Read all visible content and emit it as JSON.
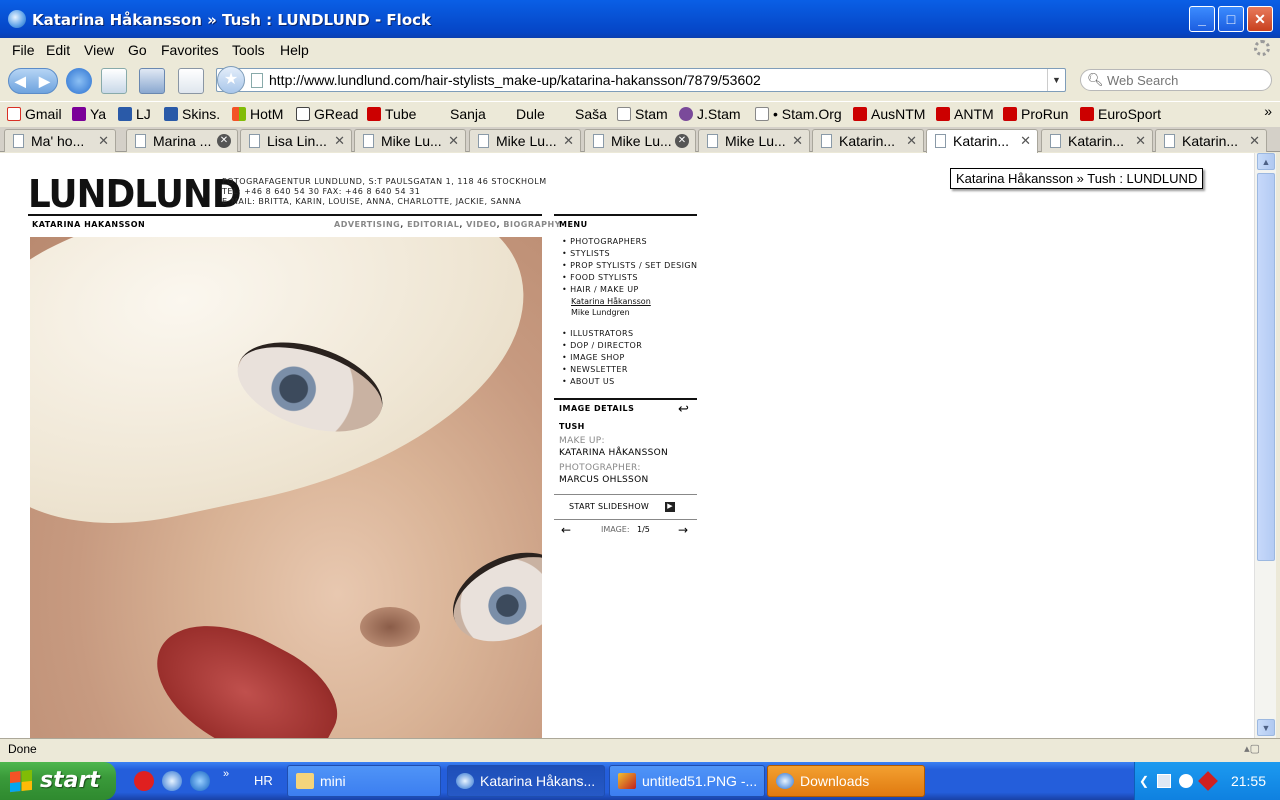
{
  "window": {
    "title": "Katarina Håkansson » Tush : LUNDLUND - Flock",
    "buttons": {
      "minimize": "_",
      "maximize": "□",
      "close": "✕"
    }
  },
  "menubar": [
    "File",
    "Edit",
    "View",
    "Go",
    "Favorites",
    "Tools",
    "Help"
  ],
  "navbar": {
    "url": "http://www.lundlund.com/hair-stylists_make-up/katarina-hakansson/7879/53602",
    "search_placeholder": "Web Search"
  },
  "bookmarks": [
    {
      "label": "Gmail",
      "icon": "gmail-icon",
      "color": "#d93025"
    },
    {
      "label": "Ya",
      "icon": "yahoo-icon",
      "color": "#7b0099"
    },
    {
      "label": "LJ",
      "icon": "pencil-icon",
      "color": "#2a5aa8"
    },
    {
      "label": "Skins.",
      "icon": "pencil-icon",
      "color": "#2a5aa8"
    },
    {
      "label": "HotM",
      "icon": "windows-icon",
      "color": "#f35325"
    },
    {
      "label": "GRead",
      "icon": "google-icon",
      "color": "#444444"
    },
    {
      "label": "Tube",
      "icon": "youtube-icon",
      "color": "#cc0000"
    },
    {
      "label": "Sanja",
      "icon": "none",
      "color": ""
    },
    {
      "label": "Dule",
      "icon": "none",
      "color": ""
    },
    {
      "label": "Saša",
      "icon": "none",
      "color": ""
    },
    {
      "label": "Stam",
      "icon": "page-icon",
      "color": "#ffffff"
    },
    {
      "label": "J.Stam",
      "icon": "fs-icon",
      "color": "#7a4a9a"
    },
    {
      "label": "• Stam.Org",
      "icon": "page-icon",
      "color": "#ffffff"
    },
    {
      "label": "AusNTM",
      "icon": "youtube-icon",
      "color": "#cc0000"
    },
    {
      "label": "ANTM",
      "icon": "youtube-icon",
      "color": "#cc0000"
    },
    {
      "label": "ProRun",
      "icon": "youtube-icon",
      "color": "#cc0000"
    },
    {
      "label": "EuroSport",
      "icon": "yahoo-icon",
      "color": "#cc0000"
    }
  ],
  "bookmarks_more": "»",
  "tabs": [
    {
      "label": "Ma' ho...",
      "close": "✕"
    },
    {
      "label": "Marina ...",
      "close": "✕"
    },
    {
      "label": "Lisa Lin...",
      "close": "✕"
    },
    {
      "label": "Mike Lu...",
      "close": "✕"
    },
    {
      "label": "Mike Lu...",
      "close": "✕"
    },
    {
      "label": "Mike Lu...",
      "close": "✕"
    },
    {
      "label": "Mike Lu...",
      "close": "✕"
    },
    {
      "label": "Katarin...",
      "close": "✕"
    },
    {
      "label": "Katarin...",
      "close": "✕"
    },
    {
      "label": "Katarin...",
      "close": "✕"
    },
    {
      "label": "Katarin...",
      "close": "✕"
    }
  ],
  "page": {
    "logo": "LUNDLUND",
    "agency_lines": [
      "FOTOGRAFAGENTUR LUNDLUND, S:T PAULSGATAN 1, 118 46 STOCKHOLM",
      "TEL: +46 8 640 54 30  FAX: +46 8 640 54 31",
      "E-MAIL: BRITTA, KARIN, LOUISE, ANNA, CHARLOTTE, JACKIE, SANNA"
    ],
    "artist_heading": "KATARINA HAKANSSON",
    "subnav": [
      "ADVERTISING",
      "EDITORIAL",
      "VIDEO",
      "BIOGRAPHY"
    ],
    "menu_title": "MENU",
    "menu_items_top": [
      "PHOTOGRAPHERS",
      "STYLISTS",
      "PROP STYLISTS / SET DESIGN",
      "FOOD STYLISTS",
      "HAIR / MAKE UP"
    ],
    "menu_sub": [
      "Katarina Håkansson",
      "Mike Lundgren"
    ],
    "menu_items_bottom": [
      "ILLUSTRATORS",
      "DOP / DIRECTOR",
      "IMAGE SHOP",
      "NEWSLETTER",
      "ABOUT US"
    ],
    "details_title": "IMAGE DETAILS",
    "details_back": "↩",
    "image_title": "TUSH",
    "makeup_label": "MAKE UP:",
    "makeup_value": "KATARINA HÅKANSSON",
    "photographer_label": "PHOTOGRAPHER:",
    "photographer_value": "MARCUS OHLSSON",
    "slideshow_label": "START SLIDESHOW",
    "pager_prev": "←",
    "pager_label": "IMAGE:",
    "pager_value": "1/5",
    "pager_next": "→",
    "tooltip": "Katarina Håkansson » Tush : LUNDLUND"
  },
  "status": {
    "text": "Done"
  },
  "taskbar": {
    "start": "start",
    "lang": "HR",
    "chevron": "»",
    "tasks": [
      {
        "label": "mini",
        "active": false
      },
      {
        "label": "Katarina Håkans...",
        "active": true
      },
      {
        "label": "untitled51.PNG -...",
        "active": false
      },
      {
        "label": "Downloads",
        "active": false
      }
    ],
    "clock": "21:55"
  }
}
